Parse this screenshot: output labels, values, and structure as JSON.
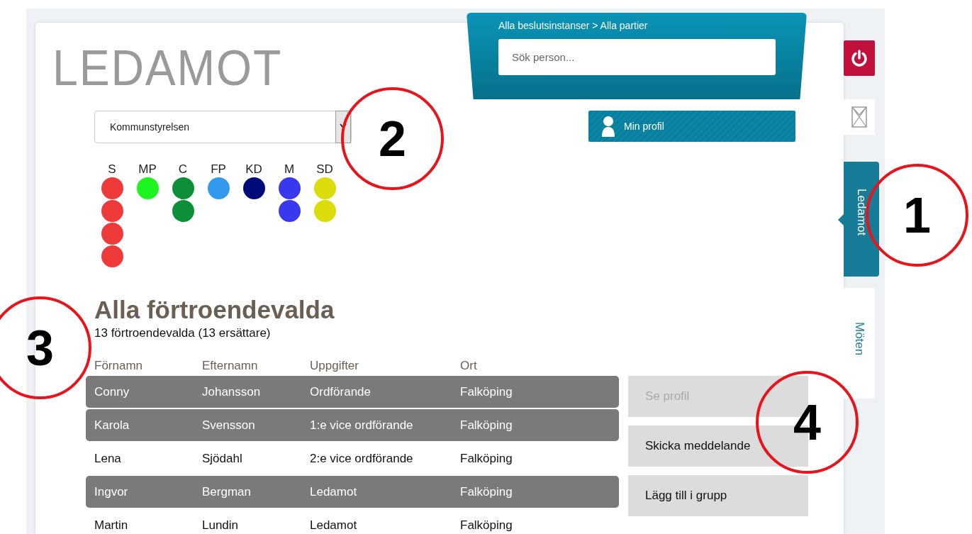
{
  "title": "LEDAMOT",
  "breadcrumb": "Alla beslutsinstanser > Alla partier",
  "search": {
    "placeholder": "Sök person..."
  },
  "body_select": {
    "value": "Kommunstyrelsen"
  },
  "profile_button": {
    "label": "Min profil"
  },
  "parties": [
    {
      "label": "S",
      "dots": [
        {
          "color": "#f03a3a"
        },
        {
          "color": "#f03a3a"
        },
        {
          "color": "#f03a3a"
        },
        {
          "color": "#f03a3a"
        }
      ]
    },
    {
      "label": "MP",
      "dots": [
        {
          "color": "#1ef51e"
        }
      ]
    },
    {
      "label": "C",
      "dots": [
        {
          "color": "#0d8f3a"
        },
        {
          "color": "#0d8f3a"
        }
      ]
    },
    {
      "label": "FP",
      "dots": [
        {
          "color": "#3399ee"
        }
      ]
    },
    {
      "label": "KD",
      "dots": [
        {
          "color": "#000a78"
        }
      ]
    },
    {
      "label": "M",
      "dots": [
        {
          "color": "#3838ee"
        },
        {
          "color": "#3838ee"
        }
      ]
    },
    {
      "label": "SD",
      "dots": [
        {
          "color": "#dcdc0a"
        },
        {
          "color": "#dcdc0a"
        }
      ]
    }
  ],
  "heading": "Alla förtroendevalda",
  "subheading": "13 förtroendevalda (13 ersättare)",
  "table": {
    "columns": [
      "Förnamn",
      "Efternamn",
      "Uppgifter",
      "Ort"
    ],
    "rows": [
      {
        "cells": [
          "Conny",
          "Johansson",
          "Ordförande",
          "Falköping"
        ],
        "selected": true
      },
      {
        "cells": [
          "Karola",
          "Svensson",
          "1:e vice ordförande",
          "Falköping"
        ],
        "selected": true
      },
      {
        "cells": [
          "Lena",
          "Sjödahl",
          "2:e vice ordförande",
          "Falköping"
        ],
        "selected": false
      },
      {
        "cells": [
          "Ingvor",
          "Bergman",
          "Ledamot",
          "Falköping"
        ],
        "selected": true
      },
      {
        "cells": [
          "Martin",
          "Lundin",
          "Ledamot",
          "Falköping"
        ],
        "selected": false
      }
    ]
  },
  "actions": [
    {
      "label": "Se profil",
      "disabled": true
    },
    {
      "label": "Skicka meddelande",
      "disabled": false
    },
    {
      "label": "Lägg till i grupp",
      "disabled": false
    }
  ],
  "side_tabs": [
    {
      "label": "Ledamot",
      "selected": true
    },
    {
      "label": "Möten",
      "selected": false
    }
  ],
  "callouts": [
    {
      "label": "2"
    },
    {
      "label": "1"
    },
    {
      "label": "3"
    },
    {
      "label": "4"
    }
  ]
}
